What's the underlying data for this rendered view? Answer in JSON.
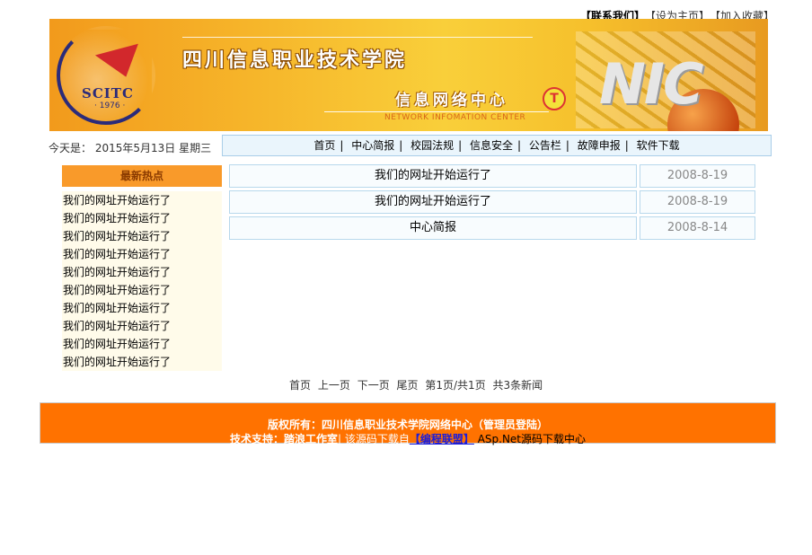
{
  "top_links": {
    "contact": "【联系我们】",
    "set_home": "【设为主页】",
    "add_fav": "【加入收藏】"
  },
  "banner": {
    "logo_text": "SCITC",
    "logo_year": "· 1976 ·",
    "school_name": "四川信息职业技术学院",
    "center_name": "信息网络中心",
    "center_en": "NETWORK INFOMATION CENTER",
    "t_mark": "T",
    "nic": "NIC"
  },
  "today": {
    "label": "今天是：",
    "value": "2015年5月13日 星期三"
  },
  "nav": {
    "items": [
      "首页",
      "中心简报",
      "校园法规",
      "信息安全",
      "公告栏",
      "故障申报",
      "软件下载"
    ]
  },
  "hot": {
    "title": "最新热点",
    "items": [
      "我们的网址开始运行了",
      "我们的网址开始运行了",
      "我们的网址开始运行了",
      "我们的网址开始运行了",
      "我们的网址开始运行了",
      "我们的网址开始运行了",
      "我们的网址开始运行了",
      "我们的网址开始运行了",
      "我们的网址开始运行了",
      "我们的网址开始运行了"
    ]
  },
  "news": [
    {
      "title": "我们的网址开始运行了",
      "date": "2008-8-19"
    },
    {
      "title": "我们的网址开始运行了",
      "date": "2008-8-19"
    },
    {
      "title": "中心简报",
      "date": "2008-8-14"
    }
  ],
  "pager": {
    "first": "首页",
    "prev": "上一页",
    "next": "下一页",
    "last": "尾页",
    "page_info": "第1页/共1页",
    "total": "共3条新闻"
  },
  "footer": {
    "copyright": "版权所有：四川信息职业技术学院网络中心（",
    "admin_login": "管理员登陆",
    "copyright_end": "）",
    "support_label": "技术支持：",
    "studio": "踏浪工作室",
    "download_from": "| 该源码下载自",
    "union": "【编程联盟】",
    "aspnet": " ASp.Net源码下载中心"
  },
  "colors": {
    "footer_bg": "#ff7200",
    "hot_head_bg": "#f99a2a",
    "nav_bg": "#eaf5fc"
  }
}
